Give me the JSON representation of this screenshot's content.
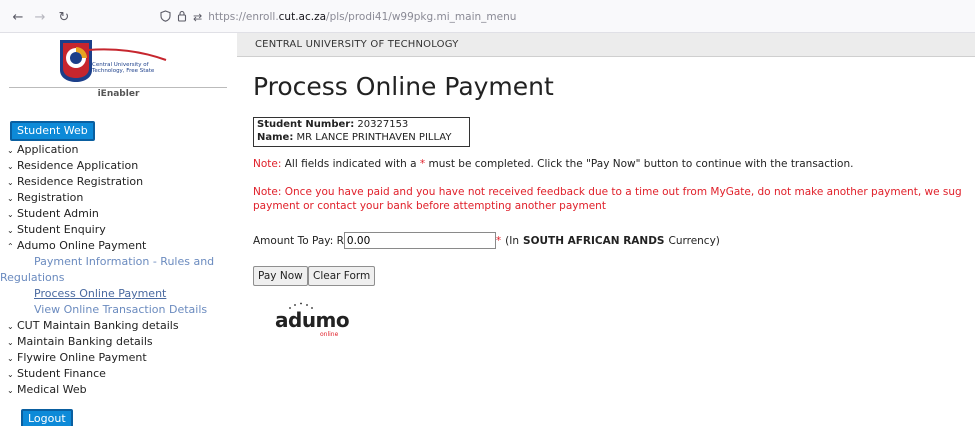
{
  "browser": {
    "url_prefix": "https://enroll.",
    "url_domain": "cut.ac.za",
    "url_suffix": "/pls/prodi41/w99pkg.mi_main_menu"
  },
  "sidebar": {
    "brand_line1": "Central University of",
    "brand_line2": "Technology, Free State",
    "ienabler": "iEnabler",
    "student_web": "Student Web",
    "items": [
      {
        "label": "Application",
        "expanded": false
      },
      {
        "label": "Residence Application",
        "expanded": false
      },
      {
        "label": "Residence Registration",
        "expanded": false
      },
      {
        "label": "Registration",
        "expanded": false
      },
      {
        "label": "Student Admin",
        "expanded": false
      },
      {
        "label": "Student Enquiry",
        "expanded": false
      },
      {
        "label": "Adumo Online Payment",
        "expanded": true
      },
      {
        "label": "CUT Maintain Banking details",
        "expanded": false
      },
      {
        "label": "Maintain Banking details",
        "expanded": false
      },
      {
        "label": "Flywire Online Payment",
        "expanded": false
      },
      {
        "label": "Student Finance",
        "expanded": false
      },
      {
        "label": "Medical Web",
        "expanded": false
      }
    ],
    "subitems": {
      "rules_line1": "Payment Information - Rules and",
      "rules_line2": "Regulations",
      "process": "Process Online Payment",
      "view": "View Online Transaction Details"
    },
    "logout": "Logout"
  },
  "topbar": {
    "title": "CENTRAL UNIVERSITY OF TECHNOLOGY"
  },
  "main": {
    "page_title": "Process Online Payment",
    "student_number_label": "Student Number:",
    "student_number": "20327153",
    "name_label": "Name:",
    "name": "MR LANCE PRINTHAVEN PILLAY",
    "note1_label": "Note:",
    "note1_a": "All fields indicated with a",
    "note1_star": "*",
    "note1_b": "must be completed. Click the \"Pay Now\" button to continue with the transaction.",
    "note2_label": "Note:",
    "note2_line1": "Once you have paid and you have not received feedback due to a time out from MyGate, do not make another payment, we sug",
    "note2_line2": "payment or contact your bank before attempting another payment",
    "amount_label": "Amount To Pay: R",
    "amount_value": "0.00",
    "amount_star": "*",
    "amount_suffix_a": "(In",
    "amount_currency": "SOUTH AFRICAN RANDS",
    "amount_suffix_b": "Currency)",
    "pay_now": "Pay Now",
    "clear_form": "Clear Form",
    "adumo_brand": "adumo",
    "adumo_sub": "online"
  }
}
